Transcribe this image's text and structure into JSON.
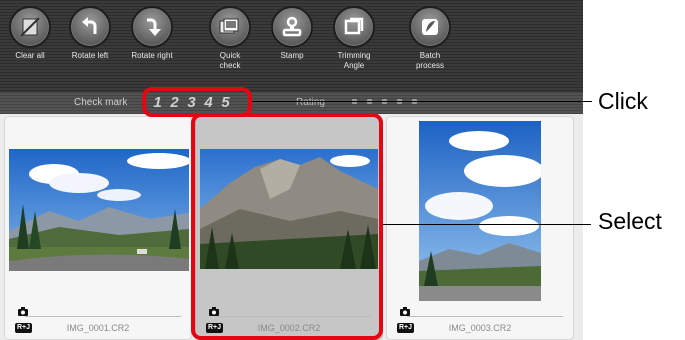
{
  "toolbar": {
    "buttons": [
      {
        "label": "Clear all",
        "icon": "clear-all-icon"
      },
      {
        "label": "Rotate left",
        "icon": "rotate-left-icon"
      },
      {
        "label": "Rotate right",
        "icon": "rotate-right-icon"
      },
      {
        "label": "Quick\ncheck",
        "icon": "quick-check-icon"
      },
      {
        "label": "Stamp",
        "icon": "stamp-icon"
      },
      {
        "label": "Trimming\nAngle",
        "icon": "trimming-angle-icon"
      },
      {
        "label": "Batch\nprocess",
        "icon": "batch-process-icon"
      }
    ]
  },
  "markbar": {
    "check_label": "Check mark",
    "check_numbers": [
      "1",
      "2",
      "3",
      "4",
      "5"
    ],
    "rating_label": "Rating",
    "rating_stars": 5
  },
  "thumbnails": [
    {
      "filename": "IMG_0001.CR2",
      "badge": "R+J",
      "selected": false
    },
    {
      "filename": "IMG_0002.CR2",
      "badge": "R+J",
      "selected": true
    },
    {
      "filename": "IMG_0003.CR2",
      "badge": "R+J",
      "selected": false
    }
  ],
  "callouts": {
    "click": "Click",
    "select": "Select"
  },
  "colors": {
    "callout_red": "#e30613"
  }
}
